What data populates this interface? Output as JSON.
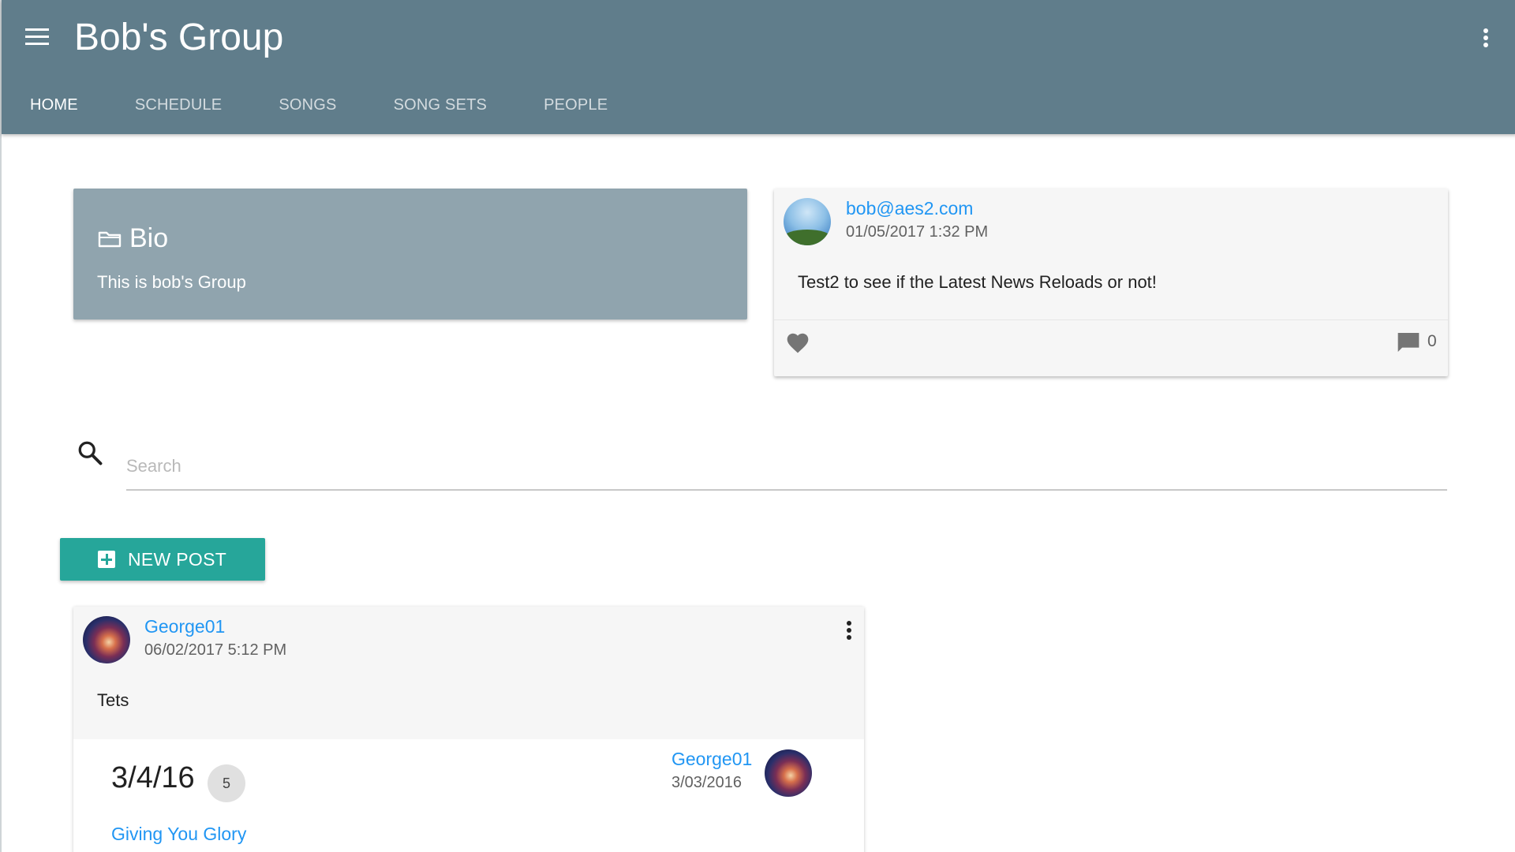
{
  "header": {
    "title": "Bob's Group",
    "tabs": [
      {
        "label": "HOME",
        "active": true
      },
      {
        "label": "SCHEDULE",
        "active": false
      },
      {
        "label": "SONGS",
        "active": false
      },
      {
        "label": "SONG SETS",
        "active": false
      },
      {
        "label": "PEOPLE",
        "active": false
      }
    ]
  },
  "bio": {
    "title": "Bio",
    "text": "This is bob's Group"
  },
  "latest_news": {
    "author": "bob@aes2.com",
    "date": "01/05/2017 1:32 PM",
    "body": "Test2 to see if the Latest News Reloads or not!",
    "comment_count": "0"
  },
  "search": {
    "placeholder": "Search"
  },
  "new_post": {
    "label": "NEW POST"
  },
  "post": {
    "author": "George01",
    "date": "06/02/2017 5:12 PM",
    "body": "Tets",
    "song_set": {
      "title": "3/4/16",
      "count": "5",
      "author": "George01",
      "date": "3/03/2016",
      "first_song": "Giving You Glory"
    }
  },
  "colors": {
    "appbar": "#607d8b",
    "bio_card": "#90a4ae",
    "accent_button": "#26a69a",
    "link": "#2196f3"
  }
}
